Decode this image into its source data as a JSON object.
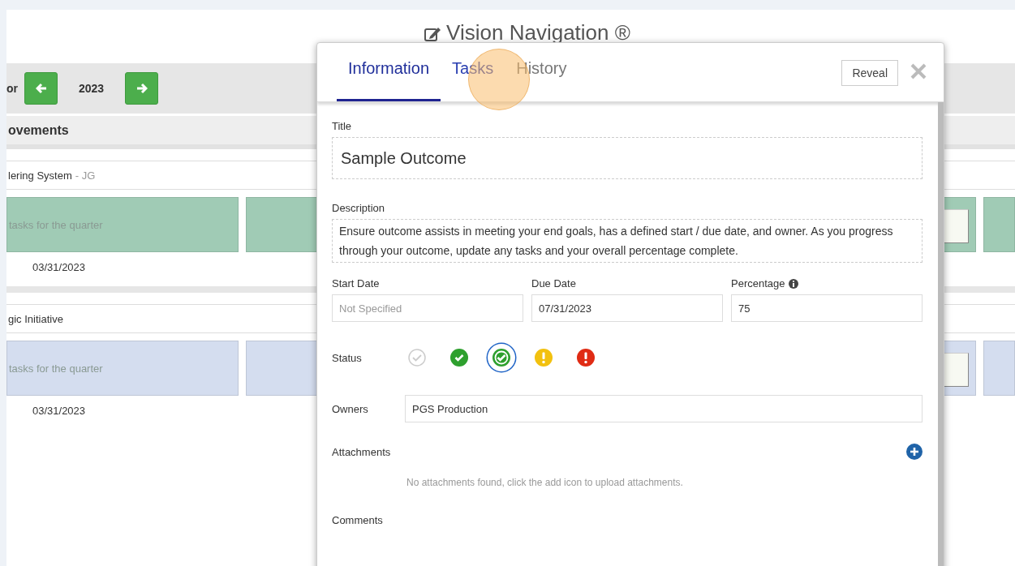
{
  "header": {
    "title": "Vision Navigation ®"
  },
  "year_bar": {
    "label": "or",
    "year": "2023"
  },
  "section": {
    "title": "ovements"
  },
  "groups": [
    {
      "name": "lering System",
      "owner": "- JG",
      "color": "#a0cbb5",
      "card_text": "tasks for the quarter",
      "date": "03/31/2023"
    },
    {
      "name": "gic Initiative",
      "color": "#d4ddef",
      "card_text": "tasks for the quarter",
      "date": "03/31/2023"
    }
  ],
  "dialog": {
    "tabs": [
      {
        "label": "Information",
        "selected": true
      },
      {
        "label": "Tasks",
        "selected": false
      },
      {
        "label": "History",
        "selected": false
      }
    ],
    "reveal_button": "Reveal",
    "title": {
      "label": "Title",
      "value": "Sample Outcome"
    },
    "description": {
      "label": "Description",
      "value": "Ensure outcome assists in meeting your end goals, has a defined start / due date, and owner. As you progress through your outcome, update any tasks and your overall percentage complete."
    },
    "start_date": {
      "label": "Start Date",
      "placeholder": "Not Specified"
    },
    "due_date": {
      "label": "Due Date",
      "value": "07/31/2023"
    },
    "percentage": {
      "label": "Percentage",
      "value": "75"
    },
    "status": {
      "label": "Status",
      "options": [
        {
          "kind": "none",
          "color": "#cccccc",
          "selected": false
        },
        {
          "kind": "check",
          "color": "#2ea02e",
          "selected": false
        },
        {
          "kind": "check",
          "color": "#2ea02e",
          "selected": true
        },
        {
          "kind": "alert",
          "color": "#f2c10f",
          "selected": false
        },
        {
          "kind": "alert",
          "color": "#e02b14",
          "selected": false
        }
      ]
    },
    "owners": {
      "label": "Owners",
      "value": "PGS Production"
    },
    "attachments": {
      "label": "Attachments",
      "empty_message": "No attachments found, click the add icon to upload attachments."
    },
    "comments": {
      "label": "Comments"
    }
  }
}
